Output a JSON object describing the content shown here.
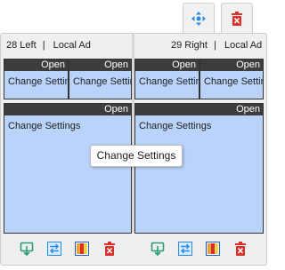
{
  "left_slot": {
    "number_label": "28 Left",
    "separator": "|",
    "ad_type": "Local Ad"
  },
  "right_slot": {
    "number_label": "29 Right",
    "separator": "|",
    "ad_type": "Local Ad"
  },
  "cells": {
    "open_label": "Open",
    "action_label": "Change Settings"
  },
  "tooltip": {
    "text": "Change Settings"
  },
  "icons": {
    "move": "move-arrows-icon",
    "delete_top": "trash-icon",
    "flip": "tv-flip-icon",
    "swap": "swap-icon",
    "layout": "color-layout-icon",
    "delete": "trash-icon"
  },
  "colors": {
    "cell_fill": "#b9d3fa",
    "header_bar": "#3d3d3d",
    "accent_blue": "#2a8be0",
    "accent_red": "#d9302a",
    "accent_green": "#2e9a7a"
  }
}
